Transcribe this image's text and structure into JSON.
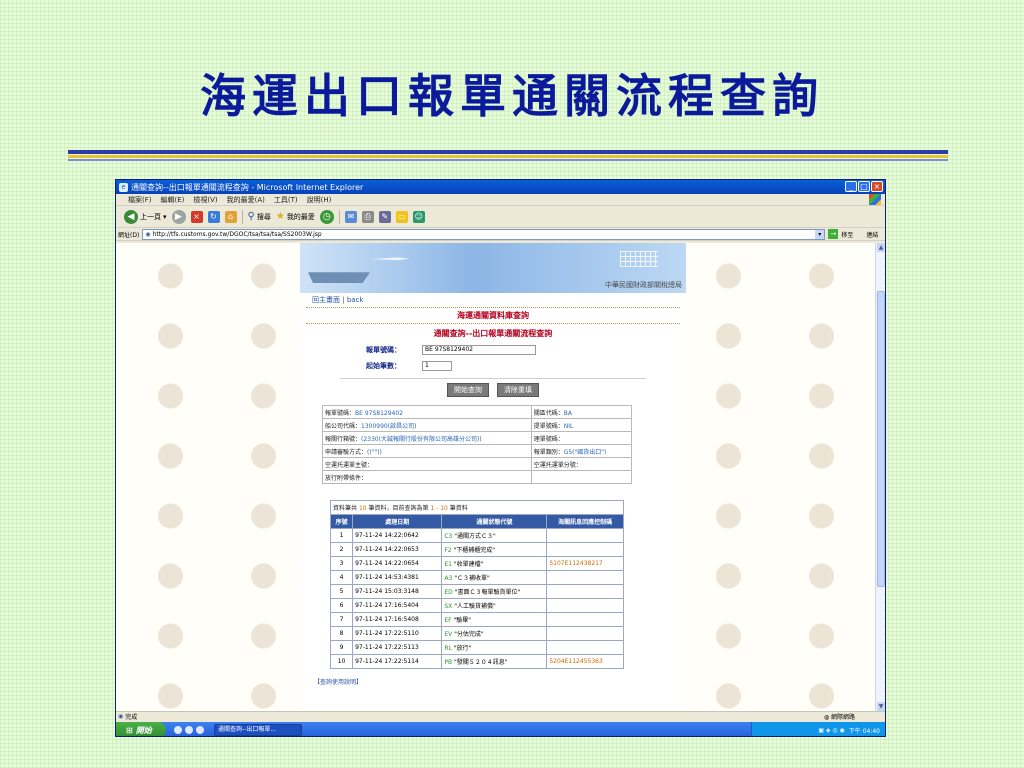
{
  "slide": {
    "title": "海運出口報單通關流程查詢"
  },
  "window": {
    "title": "通關查詢--出口報單通關流程查詢 - Microsoft Internet Explorer",
    "menus": [
      "檔案(F)",
      "編輯(E)",
      "檢視(V)",
      "我的最愛(A)",
      "工具(T)",
      "說明(H)"
    ],
    "toolbar": {
      "back": "上一頁",
      "search": "搜尋",
      "favorites": "我的最愛"
    },
    "address_label": "網址(D)",
    "url": "http://tfs.customs.gov.tw/DGOC/tsa/tsa/tsa/SS2003W.jsp",
    "go_label": "移至",
    "links_label": "連結",
    "status_text": "完成",
    "status_zone": "網際網路",
    "start_label": "開始",
    "task_label": "通關查詢--出口報單...",
    "clock": "下午 04:40"
  },
  "page": {
    "org": "中華民國財政部關稅總局",
    "nav_home": "回主畫面",
    "nav_back": "back",
    "heading1": "海運通關資料庫查詢",
    "heading2": "通關查詢--出口報單通關流程查詢",
    "field1_label": "報單號碼：",
    "field1_value": "BE 97S8129402",
    "field2_label": "起始筆數：",
    "field2_value": "1",
    "btn_query": "開始查詢",
    "btn_reset": "清除重填",
    "info": {
      "r1c1_label": "報單號碼：",
      "r1c1_value": "BE 97S8129402",
      "r1c2_label": "關區代碼：",
      "r1c2_value": "BA",
      "r2c1_label": "船公司代碼：",
      "r2c1_value": "1300990(啟昌公司)",
      "r2c2_label": "提單號碼：",
      "r2c2_value": "NIL",
      "r3c1_label": "報關行箱號：",
      "r3c1_value": "(2330(大誠報關行股份有限公司高雄分公司))",
      "r3c2_label": "理單號碼：",
      "r3c2_value": "",
      "r4c1_label": "申請審驗方式：",
      "r4c1_value": "((\"\"))",
      "r4c2_label": "報單類別：",
      "r4c2_value": "G5(\"國貨出口\")",
      "r5c1_label": "空運托運單主號：",
      "r5c1_value": "",
      "r5c2_label": "空運托運單分號：",
      "r5c2_value": "",
      "r6c1_label": "放行附帶條件：",
      "r6c1_value": ""
    },
    "list_caption_a": "資料筆共",
    "list_count": "10",
    "list_caption_b": "筆資料，目前查詢為第",
    "list_range": "1 - 10",
    "list_caption_c": "筆資料",
    "columns": [
      "序號",
      "處理日期",
      "通關狀態代號",
      "海關訊息回應控制碼"
    ],
    "rows": [
      {
        "no": "1",
        "date": "97-11-24 14:22:0642",
        "code": "C3",
        "status": "\"通關方式Ｃ３\"",
        "ctrl": ""
      },
      {
        "no": "2",
        "date": "97-11-24 14:22:0653",
        "code": "F2",
        "status": "\"下櫃補櫃完成\"",
        "ctrl": ""
      },
      {
        "no": "3",
        "date": "97-11-24 14:22:0654",
        "code": "E1",
        "status": "\"收單建檔\"",
        "ctrl": "5107E112438217"
      },
      {
        "no": "4",
        "date": "97-11-24 14:53:4381",
        "code": "A3",
        "status": "\"Ｃ３補收單\"",
        "ctrl": ""
      },
      {
        "no": "5",
        "date": "97-11-24 15:03:3148",
        "code": "ED",
        "status": "\"書面Ｃ３報單驗貨單位\"",
        "ctrl": ""
      },
      {
        "no": "6",
        "date": "97-11-24 17:16:5404",
        "code": "SX",
        "status": "\"人工驗貨補償\"",
        "ctrl": ""
      },
      {
        "no": "7",
        "date": "97-11-24 17:16:5408",
        "code": "EF",
        "status": "\"驗畢\"",
        "ctrl": ""
      },
      {
        "no": "8",
        "date": "97-11-24 17:22:5110",
        "code": "EV",
        "status": "\"分估完成\"",
        "ctrl": ""
      },
      {
        "no": "9",
        "date": "97-11-24 17:22:5113",
        "code": "RL",
        "status": "\"放行\"",
        "ctrl": ""
      },
      {
        "no": "10",
        "date": "97-11-24 17:22:5114",
        "code": "PB",
        "status": "\"發關５２０４訊息\"",
        "ctrl": "5204E112455363"
      }
    ],
    "help_link": "【查詢使用說明】"
  }
}
